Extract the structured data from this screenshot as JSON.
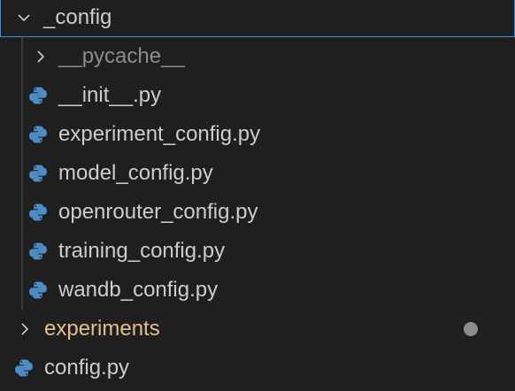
{
  "tree": {
    "config_folder": {
      "label": "_config",
      "expanded": true
    },
    "children": [
      {
        "label": "__pycache__",
        "kind": "folder",
        "expanded": false
      },
      {
        "label": "__init__.py",
        "kind": "file",
        "icon": "python-icon"
      },
      {
        "label": "experiment_config.py",
        "kind": "file",
        "icon": "python-icon"
      },
      {
        "label": "model_config.py",
        "kind": "file",
        "icon": "python-icon"
      },
      {
        "label": "openrouter_config.py",
        "kind": "file",
        "icon": "python-icon"
      },
      {
        "label": "training_config.py",
        "kind": "file",
        "icon": "python-icon"
      },
      {
        "label": "wandb_config.py",
        "kind": "file",
        "icon": "python-icon"
      }
    ],
    "experiments_folder": {
      "label": "experiments",
      "expanded": false,
      "status": "modified"
    },
    "root_file": {
      "label": "config.py",
      "icon": "python-icon"
    }
  },
  "colors": {
    "background": "#1f1f1f",
    "text": "#cccccc",
    "muted": "#8c8c8c",
    "modified": "#e2c08d",
    "python_blue": "#4e8cc6",
    "selection_border": "#3b8eea"
  }
}
